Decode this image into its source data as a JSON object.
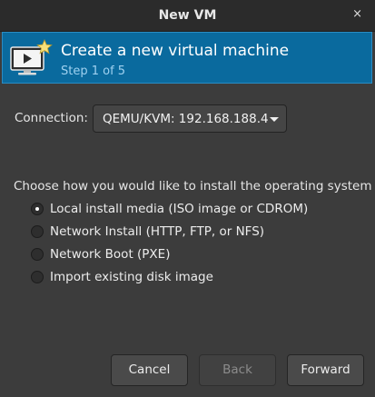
{
  "window": {
    "title": "New VM",
    "close_glyph": "×"
  },
  "banner": {
    "heading": "Create a new virtual machine",
    "step": "Step 1 of 5",
    "icon": "vm-monitor-star-icon",
    "color": "#0a6a9e"
  },
  "connection": {
    "label": "Connection:",
    "value": "QEMU/KVM: 192.168.188.4"
  },
  "install": {
    "prompt": "Choose how you would like to install the operating system",
    "options": [
      {
        "label": "Local install media (ISO image or CDROM)",
        "selected": true
      },
      {
        "label": "Network Install (HTTP, FTP, or NFS)",
        "selected": false
      },
      {
        "label": "Network Boot (PXE)",
        "selected": false
      },
      {
        "label": "Import existing disk image",
        "selected": false
      }
    ]
  },
  "buttons": {
    "cancel": "Cancel",
    "back": "Back",
    "forward": "Forward"
  }
}
